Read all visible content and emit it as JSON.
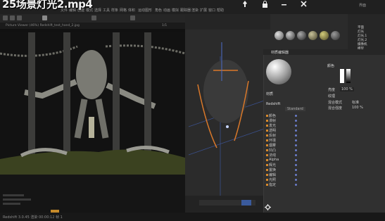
{
  "video_title": "25场景灯光2.mp4",
  "menu": {
    "items": [
      "文件",
      "编辑",
      "创建",
      "模式",
      "选择",
      "工具",
      "样条",
      "网格",
      "体积",
      "运动图形",
      "角色",
      "动画",
      "模拟",
      "跟踪器",
      "渲染",
      "扩展",
      "窗口",
      "帮助"
    ],
    "layout_label": "界面"
  },
  "render_view": {
    "filename_readout": "Picture Viewer (46%) Redshift_test_hand_2.jpg",
    "frame_readout": "1/1"
  },
  "material_editor": {
    "header": "材质编辑器",
    "material_name": "材质",
    "section_label": "Redshift",
    "channels": [
      "颜色",
      "漫射",
      "发光",
      "透明",
      "反射",
      "环境",
      "烟雾",
      "凹凸",
      "法线",
      "Alpha",
      "辉光",
      "置换",
      "编辑",
      "光照",
      "指定"
    ],
    "type_label": "Standard",
    "color_field_label": "颜色",
    "brightness_label": "亮度",
    "brightness_value": "100 %",
    "texture_label": "纹理",
    "mix_mode_label": "混合模式",
    "mix_mode_value": "标准",
    "mix_strength_label": "混合强度",
    "mix_strength_value": "100 %"
  },
  "object_manager": {
    "items": [
      "平面",
      "灯光",
      "灯光.1",
      "灯光.2",
      "摄像机",
      "模型"
    ]
  },
  "status_bar": {
    "left_text": "Redshift 3.0.45  渲染 00:00:12  帧 1"
  },
  "colors": {
    "accent": "#3a5a9c",
    "checkbox": "#d88a2c",
    "dot": "#6a7cc9"
  }
}
